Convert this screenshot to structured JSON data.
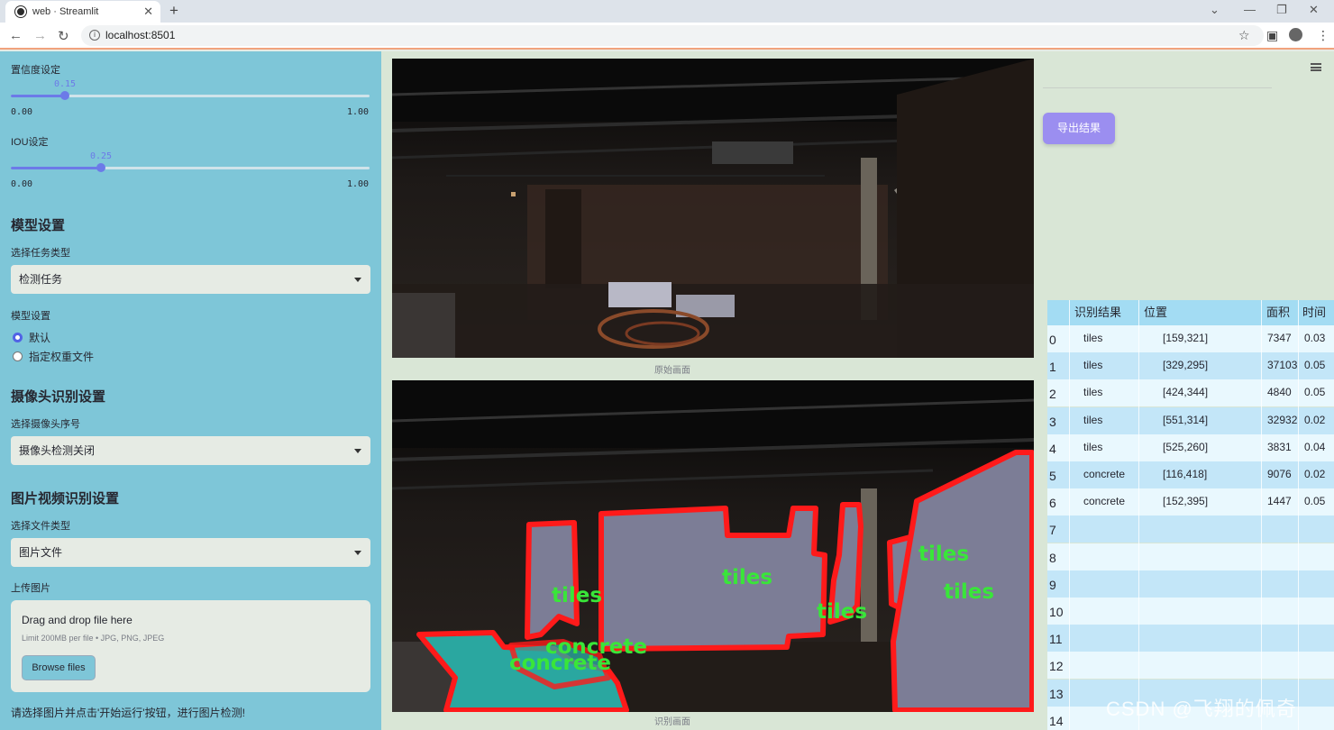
{
  "browser": {
    "tab_title": "web · Streamlit",
    "new_tab": "+",
    "url": "localhost:8501",
    "window_controls": [
      "⌄",
      "—",
      "❐",
      "✕"
    ]
  },
  "sidebar": {
    "confidence": {
      "label": "置信度设定",
      "value": 0.15,
      "value_text": "0.15",
      "min": "0.00",
      "max": "1.00"
    },
    "iou": {
      "label": "IOU设定",
      "value": 0.25,
      "value_text": "0.25",
      "min": "0.00",
      "max": "1.00"
    },
    "model_section": "模型设置",
    "task_type_label": "选择任务类型",
    "task_type_value": "检测任务",
    "model_settings_label": "模型设置",
    "model_options": [
      {
        "label": "默认",
        "selected": true
      },
      {
        "label": "指定权重文件",
        "selected": false
      }
    ],
    "camera_section": "摄像头识别设置",
    "camera_label": "选择摄像头序号",
    "camera_value": "摄像头检测关闭",
    "media_section": "图片视频识别设置",
    "file_type_label": "选择文件类型",
    "file_type_value": "图片文件",
    "upload_label": "上传图片",
    "upload": {
      "title": "Drag and drop file here",
      "hint": "Limit 200MB per file • JPG, PNG, JPEG",
      "button": "Browse files"
    },
    "footer_text": "请选择图片并点击'开始运行'按钮，进行图片检测!"
  },
  "main": {
    "original_caption": "原始画面",
    "result_caption": "识别画面",
    "export_button": "导出结果",
    "detection_labels": [
      "tiles",
      "tiles",
      "tiles",
      "tiles",
      "tiles",
      "concrete",
      "concrete"
    ]
  },
  "table": {
    "columns": [
      "",
      "识别结果",
      "位置",
      "面积",
      "时间"
    ],
    "rows": [
      {
        "idx": "0",
        "result": "tiles",
        "pos": "[159,321]",
        "area": "7347",
        "time": "0.03"
      },
      {
        "idx": "1",
        "result": "tiles",
        "pos": "[329,295]",
        "area": "37103",
        "time": "0.05"
      },
      {
        "idx": "2",
        "result": "tiles",
        "pos": "[424,344]",
        "area": "4840",
        "time": "0.05"
      },
      {
        "idx": "3",
        "result": "tiles",
        "pos": "[551,314]",
        "area": "32932",
        "time": "0.02"
      },
      {
        "idx": "4",
        "result": "tiles",
        "pos": "[525,260]",
        "area": "3831",
        "time": "0.04"
      },
      {
        "idx": "5",
        "result": "concrete",
        "pos": "[116,418]",
        "area": "9076",
        "time": "0.02"
      },
      {
        "idx": "6",
        "result": "concrete",
        "pos": "[152,395]",
        "area": "1447",
        "time": "0.05"
      },
      {
        "idx": "7",
        "result": "",
        "pos": "",
        "area": "",
        "time": ""
      },
      {
        "idx": "8",
        "result": "",
        "pos": "",
        "area": "",
        "time": ""
      },
      {
        "idx": "9",
        "result": "",
        "pos": "",
        "area": "",
        "time": ""
      },
      {
        "idx": "10",
        "result": "",
        "pos": "",
        "area": "",
        "time": ""
      },
      {
        "idx": "11",
        "result": "",
        "pos": "",
        "area": "",
        "time": ""
      },
      {
        "idx": "12",
        "result": "",
        "pos": "",
        "area": "",
        "time": ""
      },
      {
        "idx": "13",
        "result": "",
        "pos": "",
        "area": "",
        "time": ""
      },
      {
        "idx": "14",
        "result": "",
        "pos": "",
        "area": "",
        "time": ""
      }
    ]
  },
  "watermark": "CSDN @飞翔的佩奇",
  "colors": {
    "sidebar": "#7ec6d8",
    "accent": "#6c7ae8",
    "export": "#9b8ef0",
    "mask_edge": "#ff1a1a",
    "label_text": "#39e639"
  }
}
